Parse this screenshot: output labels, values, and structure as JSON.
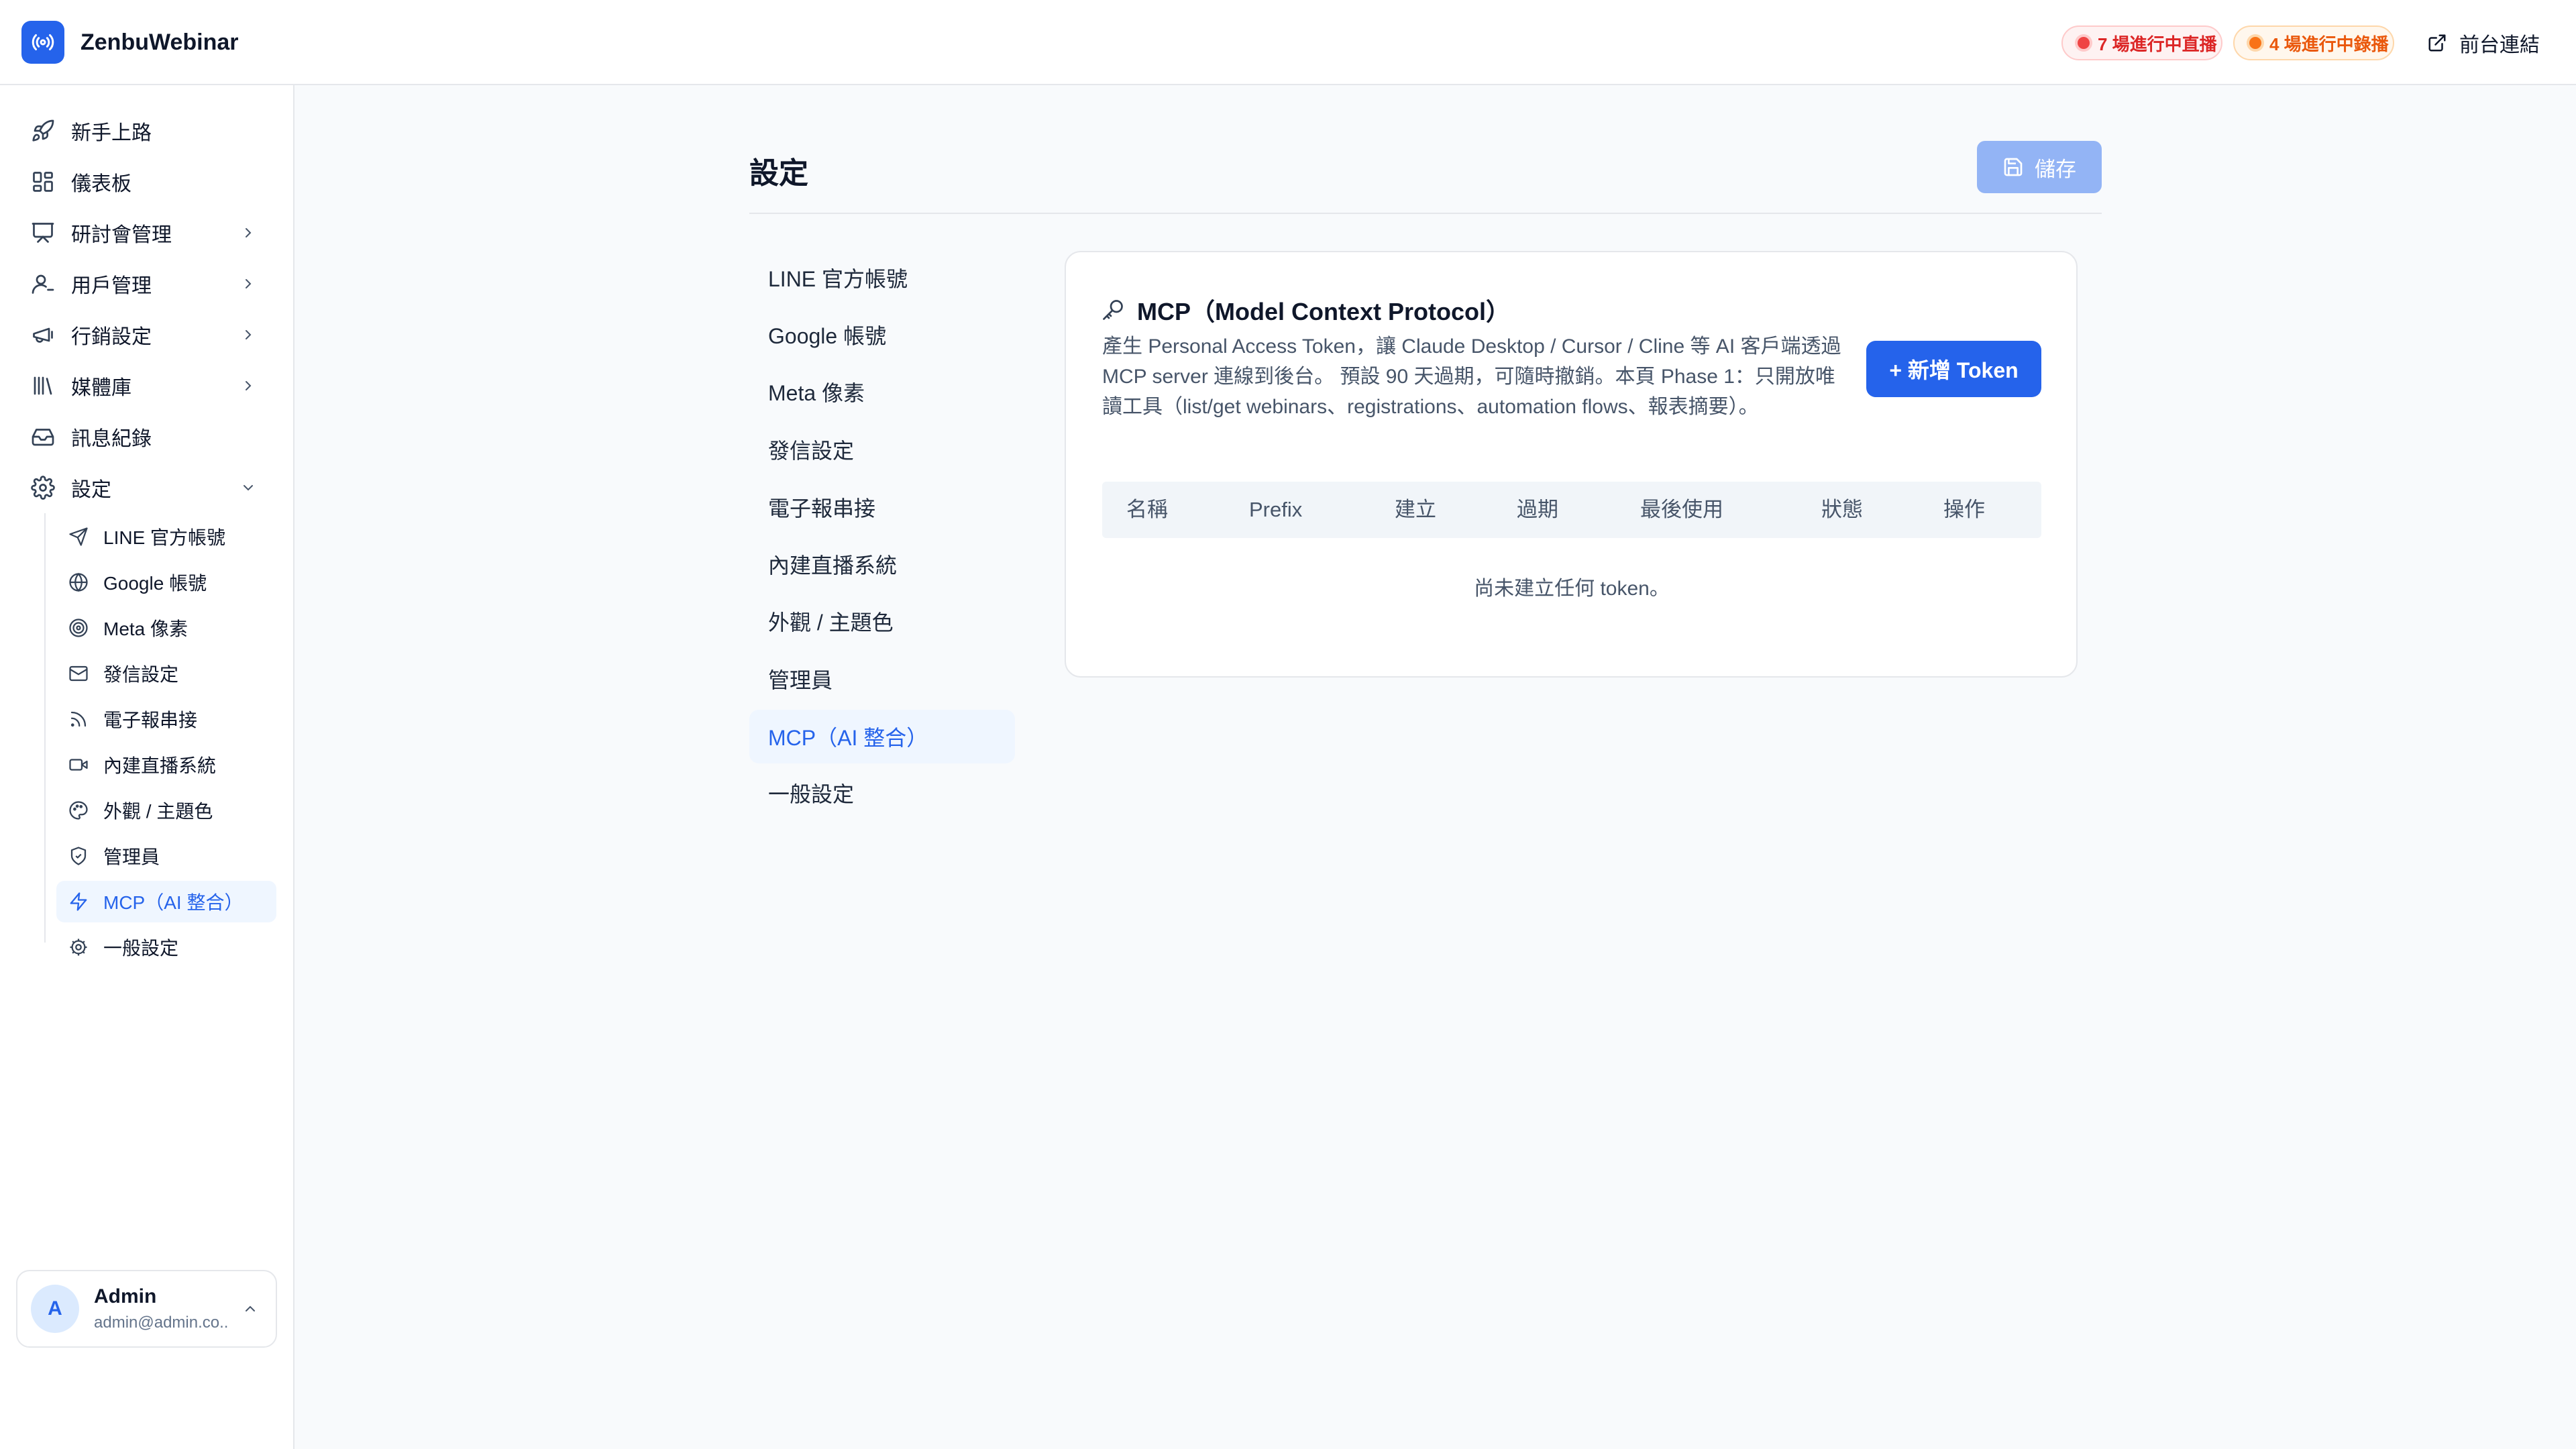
{
  "brand": {
    "name": "ZenbuWebinar"
  },
  "header": {
    "live_badge": "7 場進行中直播",
    "recording_badge": "4 場進行中錄播",
    "front_link": "前台連結"
  },
  "sidebar": {
    "items": [
      {
        "label": "新手上路"
      },
      {
        "label": "儀表板"
      },
      {
        "label": "研討會管理"
      },
      {
        "label": "用戶管理"
      },
      {
        "label": "行銷設定"
      },
      {
        "label": "媒體庫"
      },
      {
        "label": "訊息紀錄"
      },
      {
        "label": "設定"
      }
    ],
    "sub_items": [
      {
        "label": "LINE 官方帳號"
      },
      {
        "label": "Google 帳號"
      },
      {
        "label": "Meta 像素"
      },
      {
        "label": "發信設定"
      },
      {
        "label": "電子報串接"
      },
      {
        "label": "內建直播系統"
      },
      {
        "label": "外觀 / 主題色"
      },
      {
        "label": "管理員"
      },
      {
        "label": "MCP（AI 整合）"
      },
      {
        "label": "一般設定"
      }
    ],
    "user": {
      "initial": "A",
      "name": "Admin",
      "email": "admin@admin.co..."
    }
  },
  "main": {
    "title": "設定",
    "save_label": "儲存",
    "tabs": [
      {
        "label": "LINE 官方帳號"
      },
      {
        "label": "Google 帳號"
      },
      {
        "label": "Meta 像素"
      },
      {
        "label": "發信設定"
      },
      {
        "label": "電子報串接"
      },
      {
        "label": "內建直播系統"
      },
      {
        "label": "外觀 / 主題色"
      },
      {
        "label": "管理員"
      },
      {
        "label": "MCP（AI 整合）"
      },
      {
        "label": "一般設定"
      }
    ],
    "active_tab": "MCP（AI 整合）",
    "mcp": {
      "title": "MCP（Model Context Protocol）",
      "description": "產生 Personal Access Token，讓 Claude Desktop / Cursor / Cline 等 AI 客戶端透過 MCP server 連線到後台。 預設 90 天過期，可隨時撤銷。本頁 Phase 1：只開放唯讀工具（list/get webinars、registrations、automation flows、報表摘要）。",
      "add_button": "+ 新增 Token",
      "columns": [
        "名稱",
        "Prefix",
        "建立",
        "過期",
        "最後使用",
        "狀態",
        "操作"
      ],
      "empty_text": "尚未建立任何 token。"
    }
  },
  "colors": {
    "accent": "#2563eb",
    "live": "#dc2626",
    "recording": "#ea580c"
  }
}
